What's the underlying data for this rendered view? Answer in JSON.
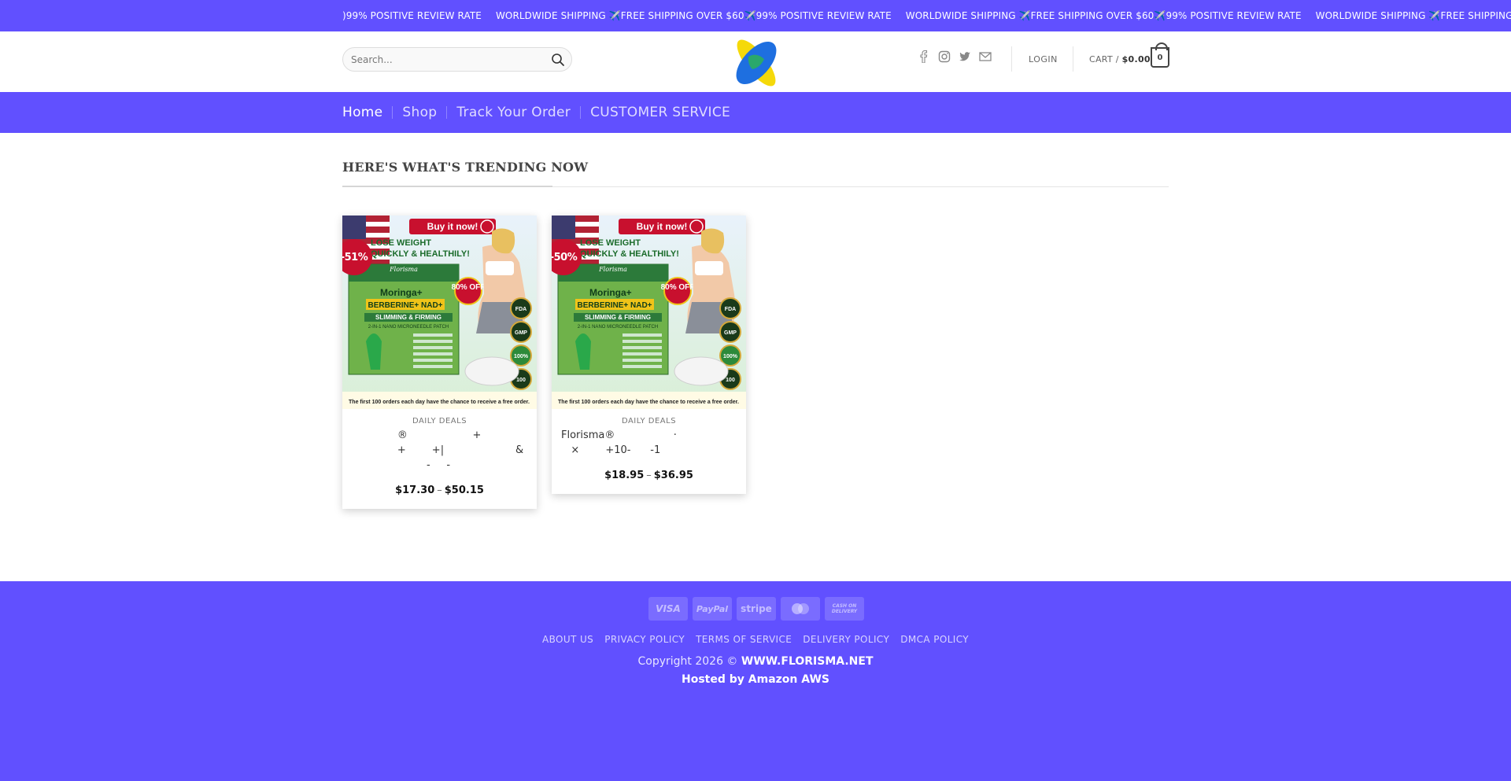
{
  "topbar": {
    "items": [
      ")99% POSITIVE REVIEW RATE",
      "WORLDWIDE SHIPPING ✈️FREE SHIPPING OVER $60✈️99% POSITIVE REVIEW RATE",
      "WORLDWIDE SHIPPING ✈️FREE SHIPPING OVER $60✈️99% POSITIVE REVIEW RATE",
      "WORLDWIDE SHIPPING ✈️FREE SHIPPING OVER $60"
    ]
  },
  "header": {
    "search_placeholder": "Search...",
    "login": "LOGIN",
    "cart_label": "CART /",
    "cart_total": "$0.00",
    "cart_count": "0"
  },
  "nav": {
    "items": [
      "Home",
      "Shop",
      "Track Your Order",
      "CUSTOMER SERVICE"
    ]
  },
  "section": {
    "title": "HERE'S WHAT'S TRENDING NOW"
  },
  "products": [
    {
      "badge": "-51%",
      "category": "DAILY DEALS",
      "name": "              ®                    +\n              +        +|                      &\n                       -     -",
      "price_low": "$17.30",
      "price_sep": "–",
      "price_high": "$50.15",
      "image": {
        "banner": "Buy it now!",
        "headline": "LOSE WEIGHT QUICKLY & HEALTHILY!",
        "brand": "Florisma",
        "product_lines": [
          "Moringa+",
          "BERBERINE+ NAD+"
        ],
        "tagline": "SLIMMING & FIRMING",
        "subtagline": "2-IN-1 NANO MICRONEEDLE PATCH",
        "discount": "80% OFF",
        "seals": [
          "FDA",
          "GMP",
          "100%",
          "100"
        ],
        "footer": "The first 100 orders each day have the chance to receive a free order."
      }
    },
    {
      "badge": "-50%",
      "category": "DAILY DEALS",
      "name": "Florisma®                  ·\n   ×        +10-      -1",
      "price_low": "$18.95",
      "price_sep": "–",
      "price_high": "$36.95",
      "image": {
        "banner": "Buy it now!",
        "headline": "LOSE WEIGHT QUICKLY & HEALTHILY!",
        "brand": "Florisma",
        "product_lines": [
          "Moringa+",
          "BERBERINE+ NAD+"
        ],
        "tagline": "SLIMMING & FIRMING",
        "subtagline": "2-IN-1 NANO MICRONEEDLE PATCH",
        "discount": "80% OFF",
        "seals": [
          "FDA",
          "GMP",
          "100%",
          "100"
        ],
        "footer": "The first 100 orders each day have the chance to receive a free order."
      }
    }
  ],
  "footer": {
    "payments": [
      "VISA",
      "PayPal",
      "stripe",
      "Mastercard",
      "CASH ON DELIVERY"
    ],
    "links": [
      "ABOUT US",
      "PRIVACY POLICY",
      "TERMS OF SERVICE",
      "DELIVERY POLICY",
      "DMCA POLICY"
    ],
    "copyright_prefix": "Copyright 2026 ©",
    "site": "WWW.FLORISMA.NET",
    "hosted": "Hosted by Amazon AWS"
  },
  "colors": {
    "brand_purple": "#6150ff",
    "sale_badge": "#c8102e"
  }
}
